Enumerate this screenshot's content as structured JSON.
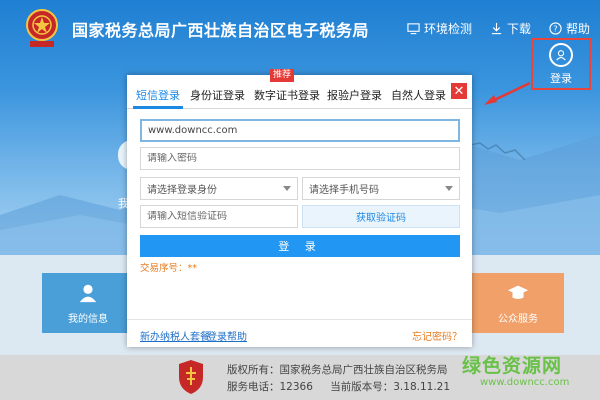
{
  "header": {
    "title": "国家税务总局广西壮族自治区电子税务局",
    "links": [
      {
        "label": "环境检测",
        "icon": "desktop-icon"
      },
      {
        "label": "下载",
        "icon": "download-icon"
      },
      {
        "label": "帮助",
        "icon": "help-icon"
      }
    ],
    "login_label": "登录"
  },
  "background": {
    "side_char": "我",
    "tile_left_label": "我的信息",
    "tile_right_label": "公众服务"
  },
  "dialog": {
    "tabs": [
      {
        "label": "短信登录",
        "active": true
      },
      {
        "label": "身份证登录"
      },
      {
        "label": "数字证书登录",
        "badge": "推荐"
      },
      {
        "label": "报验户登录"
      },
      {
        "label": "自然人登录"
      }
    ],
    "close_label": "✕",
    "username_value": "www.downcc.com",
    "password_placeholder": "请输入密码",
    "identity_placeholder": "请选择登录身份",
    "phone_placeholder": "请选择手机号码",
    "sms_placeholder": "请输入短信验证码",
    "get_code_label": "获取验证码",
    "login_button": "登 录",
    "transaction_no": "交易序号：**",
    "footer": {
      "new_taxpayer": "新办纳税人套餐",
      "login_help": "登录帮助",
      "forgot_password": "忘记密码？"
    }
  },
  "footer": {
    "copyright": "版权所有：国家税务总局广西壮族自治区税务局",
    "phone": "服务电话：12366",
    "version": "当前版本号：3.18.11.21"
  },
  "watermark": {
    "text": "绿色资源网",
    "sub": "www.downcc.com"
  },
  "colors": {
    "accent": "#1e88e5",
    "close": "#e53935",
    "warning": "#e67e22"
  }
}
